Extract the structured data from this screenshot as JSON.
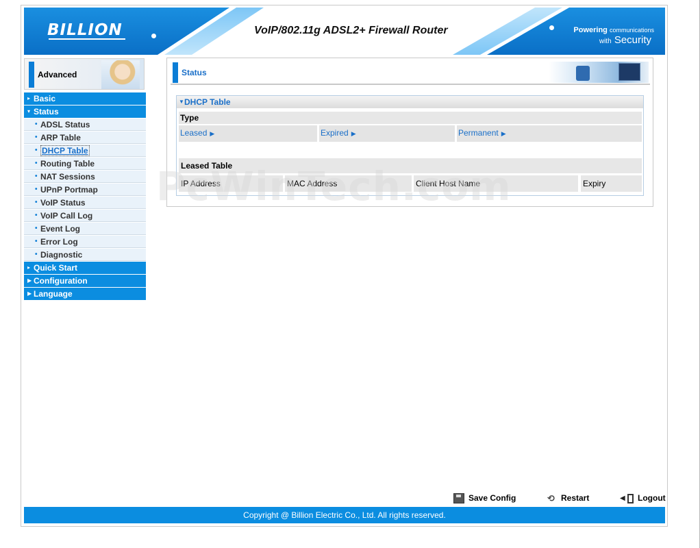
{
  "header": {
    "logo_text": "BILLION",
    "product_title": "VoIP/802.11g ADSL2+ Firewall Router",
    "tagline_bold": "Powering",
    "tagline_small": "communications",
    "tagline_with": "with",
    "tagline_security": "Security"
  },
  "sidebar": {
    "mode_label": "Advanced",
    "items": [
      {
        "label": "Basic",
        "type": "main",
        "mark": "▸"
      },
      {
        "label": "Status",
        "type": "main",
        "mark": "▾"
      },
      {
        "label": "ADSL Status",
        "type": "sub"
      },
      {
        "label": "ARP Table",
        "type": "sub"
      },
      {
        "label": "DHCP Table",
        "type": "sub"
      },
      {
        "label": "Routing Table",
        "type": "sub"
      },
      {
        "label": "NAT Sessions",
        "type": "sub"
      },
      {
        "label": "UPnP Portmap",
        "type": "sub"
      },
      {
        "label": "VoIP Status",
        "type": "sub"
      },
      {
        "label": "VoIP Call Log",
        "type": "sub"
      },
      {
        "label": "Event Log",
        "type": "sub"
      },
      {
        "label": "Error Log",
        "type": "sub"
      },
      {
        "label": "Diagnostic",
        "type": "sub"
      },
      {
        "label": "Quick Start",
        "type": "main",
        "mark": "▸"
      },
      {
        "label": "Configuration",
        "type": "main",
        "mark": "▶"
      },
      {
        "label": "Language",
        "type": "main",
        "mark": "▶"
      }
    ],
    "active_item": "DHCP Table"
  },
  "main": {
    "page_title": "Status",
    "section_title": "DHCP Table",
    "type_label": "Type",
    "tabs": [
      {
        "label": "Leased"
      },
      {
        "label": "Expired"
      },
      {
        "label": "Permanent"
      }
    ],
    "leased_table": {
      "title": "Leased Table",
      "columns": [
        "IP Address",
        "MAC Address",
        "Client Host Name",
        "Expiry"
      ],
      "rows": []
    }
  },
  "watermark": "PcWinTech.com",
  "footer": {
    "save_label": "Save Config",
    "restart_label": "Restart",
    "logout_label": "Logout",
    "copyright": "Copyright @ Billion Electric Co., Ltd. All rights reserved."
  },
  "icons": {
    "save": "floppy-disk-icon",
    "restart": "restart-icon",
    "logout": "logout-door-icon"
  },
  "colors": {
    "brand_blue": "#0b8de0",
    "accent_blue": "#0b7dd6",
    "link_blue": "#1a6fc8",
    "submenu_bg": "#e9f2fa"
  }
}
